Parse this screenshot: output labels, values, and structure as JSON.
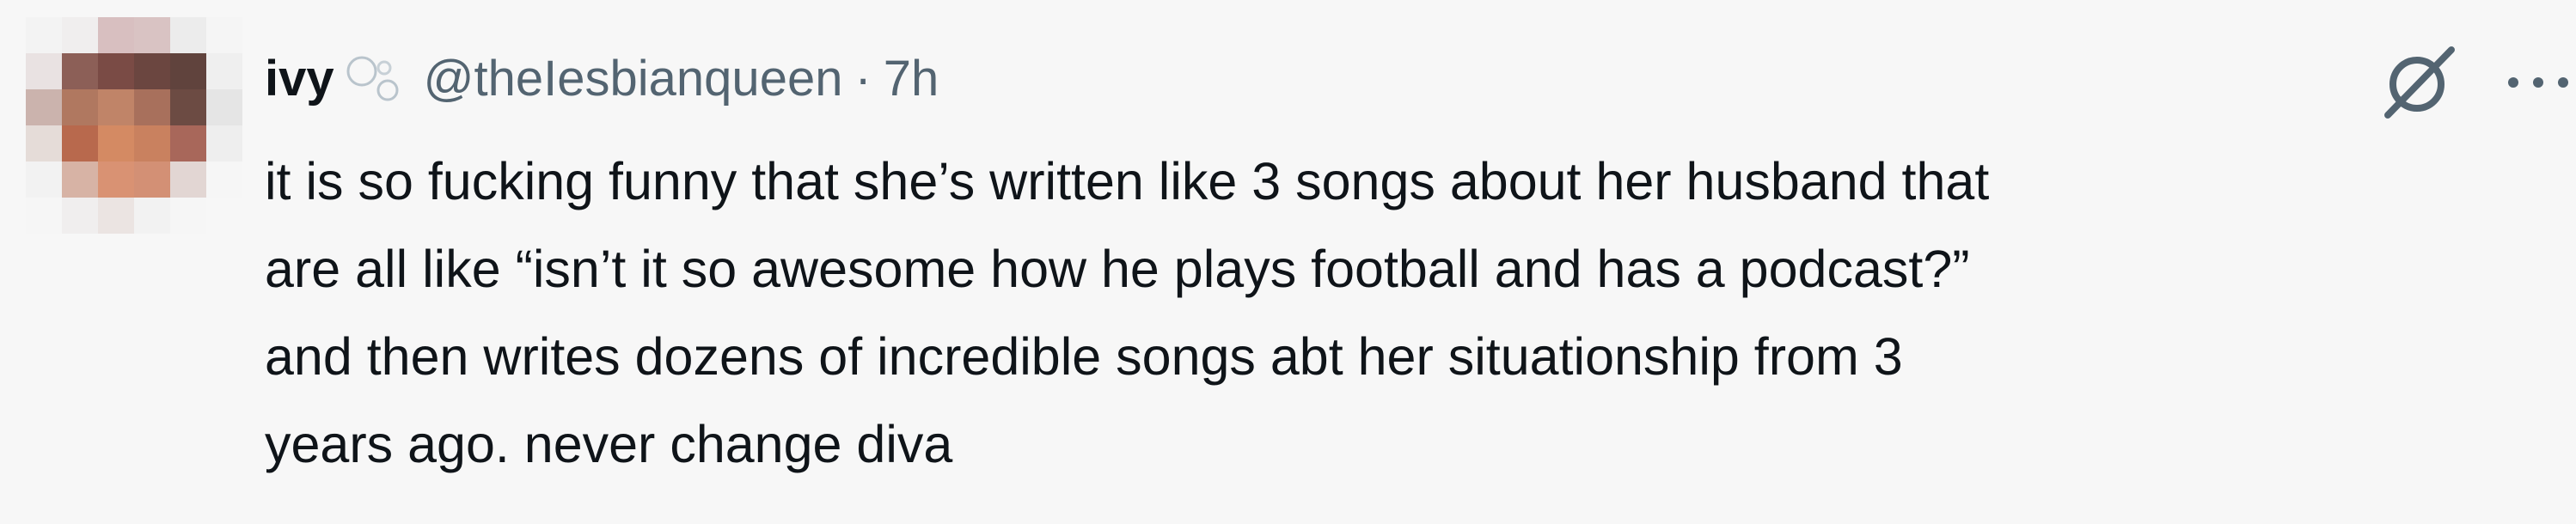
{
  "author": {
    "display_name": "ivy",
    "handle": "@theIesbianqueen",
    "separator": "·",
    "timestamp": "7h"
  },
  "tweet": {
    "lines": [
      "it is so fucking funny that she’s written like 3 songs about her husband that",
      "are all like “isn’t it so awesome how he plays football and has a podcast?”",
      "and then writes dozens of incredible songs abt her situationship from 3",
      "years ago. never change diva"
    ]
  },
  "icons": {
    "avatar": "pixelated-avatar",
    "bubbles": "bubbles-icon",
    "grok": "grok-icon",
    "more": "more-icon"
  },
  "colors": {
    "background": "#f7f7f7",
    "text": "#0f1419",
    "secondary_text": "#536471"
  }
}
